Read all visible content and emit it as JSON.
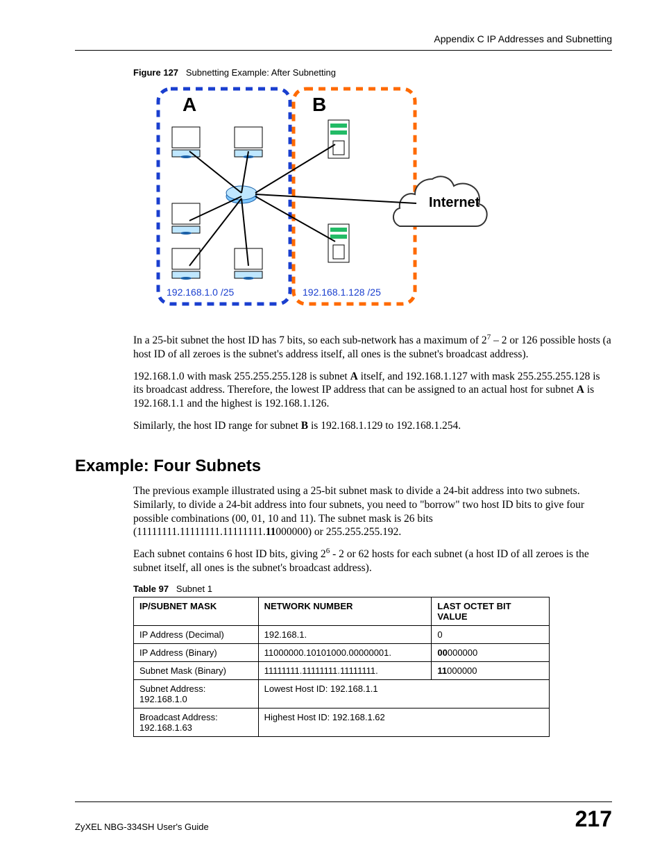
{
  "header": "Appendix C IP Addresses and Subnetting",
  "figure": {
    "caption_num": "Figure 127",
    "caption_text": "Subnetting Example: After Subnetting",
    "labelA": "A",
    "labelB": "B",
    "cloud": "Internet",
    "ipA": "192.168.1.0 /25",
    "ipB": "192.168.1.128 /25"
  },
  "para1_a": "In a 25-bit subnet the host ID has 7 bits, so each sub-network has a maximum of 2",
  "para1_sup": "7",
  "para1_b": " – 2 or 126 possible hosts (a host ID of all zeroes is the subnet's address itself, all ones is the subnet's broadcast address).",
  "para2_a": "192.168.1.0 with mask 255.255.255.128 is subnet ",
  "para2_bold1": "A",
  "para2_b": " itself, and 192.168.1.127 with mask 255.255.255.128 is its broadcast address. Therefore, the lowest IP address that can be assigned to an actual host for subnet ",
  "para2_bold2": "A",
  "para2_c": " is 192.168.1.1 and the highest is 192.168.1.126.",
  "para3_a": "Similarly, the host ID range for subnet ",
  "para3_bold": "B",
  "para3_b": " is 192.168.1.129 to 192.168.1.254.",
  "section_title": "Example: Four Subnets",
  "para4_a": "The previous example illustrated using a 25-bit subnet mask to divide a 24-bit address into two subnets. Similarly, to divide a 24-bit address into four subnets, you need to \"borrow\" two host ID bits to give four possible combinations (00, 01, 10 and 11). The subnet mask is 26 bits (11111111.11111111.11111111.",
  "para4_bold": "11",
  "para4_b": "000000) or 255.255.255.192.",
  "para5_a": "Each subnet contains 6 host ID bits, giving 2",
  "para5_sup": "6",
  "para5_b": " - 2 or 62 hosts for each subnet (a host ID of all zeroes is the subnet itself, all ones is the subnet's broadcast address).",
  "table": {
    "caption_num": "Table 97",
    "caption_text": "Subnet 1",
    "head": [
      "IP/SUBNET MASK",
      "NETWORK NUMBER",
      "LAST OCTET BIT VALUE"
    ],
    "rows": [
      {
        "c1": "IP Address (Decimal)",
        "c2": "192.168.1.",
        "c3": "0"
      },
      {
        "c1": "IP Address (Binary)",
        "c2": "11000000.10101000.00000001.",
        "c3_bold": "00",
        "c3_rest": "000000"
      },
      {
        "c1": "Subnet Mask (Binary)",
        "c2": "11111111.11111111.11111111.",
        "c3_bold": "11",
        "c3_rest": "000000"
      },
      {
        "c1": "Subnet Address: 192.168.1.0",
        "c2span": "Lowest Host ID: 192.168.1.1"
      },
      {
        "c1": "Broadcast Address: 192.168.1.63",
        "c2span": "Highest Host ID: 192.168.1.62"
      }
    ]
  },
  "footer_left": "ZyXEL NBG-334SH User's Guide",
  "footer_right": "217"
}
